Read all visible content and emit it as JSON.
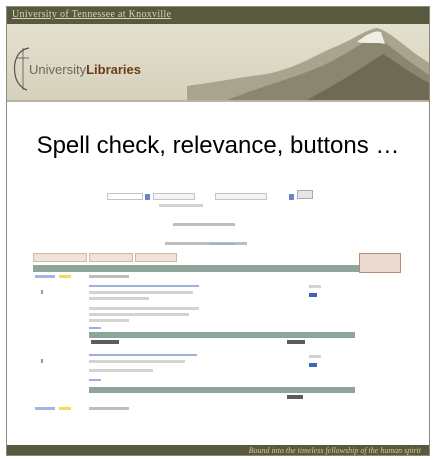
{
  "header": {
    "university_link": "University of Tennessee at Knoxville"
  },
  "banner": {
    "prefix": "University",
    "name": "Libraries"
  },
  "slide": {
    "title": "Spell check, relevance, buttons …"
  },
  "footer": {
    "tagline": "Bound into the timeless fellowship of the human spirit"
  },
  "colors": {
    "header_bg": "#58593f",
    "banner_bg": "#d6d1bc",
    "results_bar": "#8fa59a",
    "highlight": "#f3dc5a",
    "link_blue": "#3f64b8",
    "tab_bg": "#efe2d9"
  }
}
